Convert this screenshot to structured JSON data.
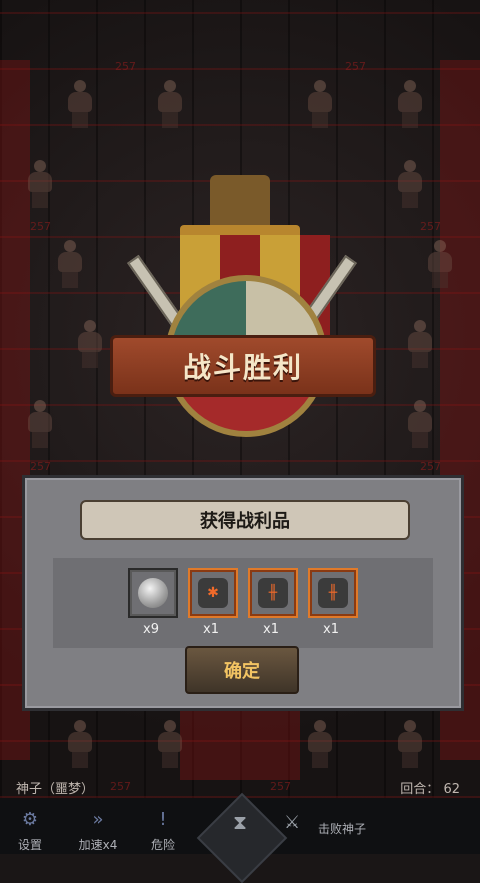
{
  "background": {
    "damage_number": "257"
  },
  "victory": {
    "title": "战斗胜利"
  },
  "rewards_panel": {
    "title": "获得战利品",
    "items": [
      {
        "icon": "silver-coin",
        "qty": "x9"
      },
      {
        "icon": "rune-stone",
        "qty": "x1"
      },
      {
        "icon": "rune-stone",
        "qty": "x1"
      },
      {
        "icon": "rune-stone",
        "qty": "x1"
      }
    ],
    "confirm_label": "确定"
  },
  "info_bar": {
    "enemy_name": "神子（噩梦）",
    "round_label": "回合：",
    "round_value": "62"
  },
  "bottom_bar": {
    "settings_label": "设置",
    "speed_label": "加速x4",
    "danger_label": "危险",
    "objective_label": "击败神子"
  },
  "colors": {
    "accent_orange": "#e07a2a",
    "confirm_text": "#f2c463"
  }
}
